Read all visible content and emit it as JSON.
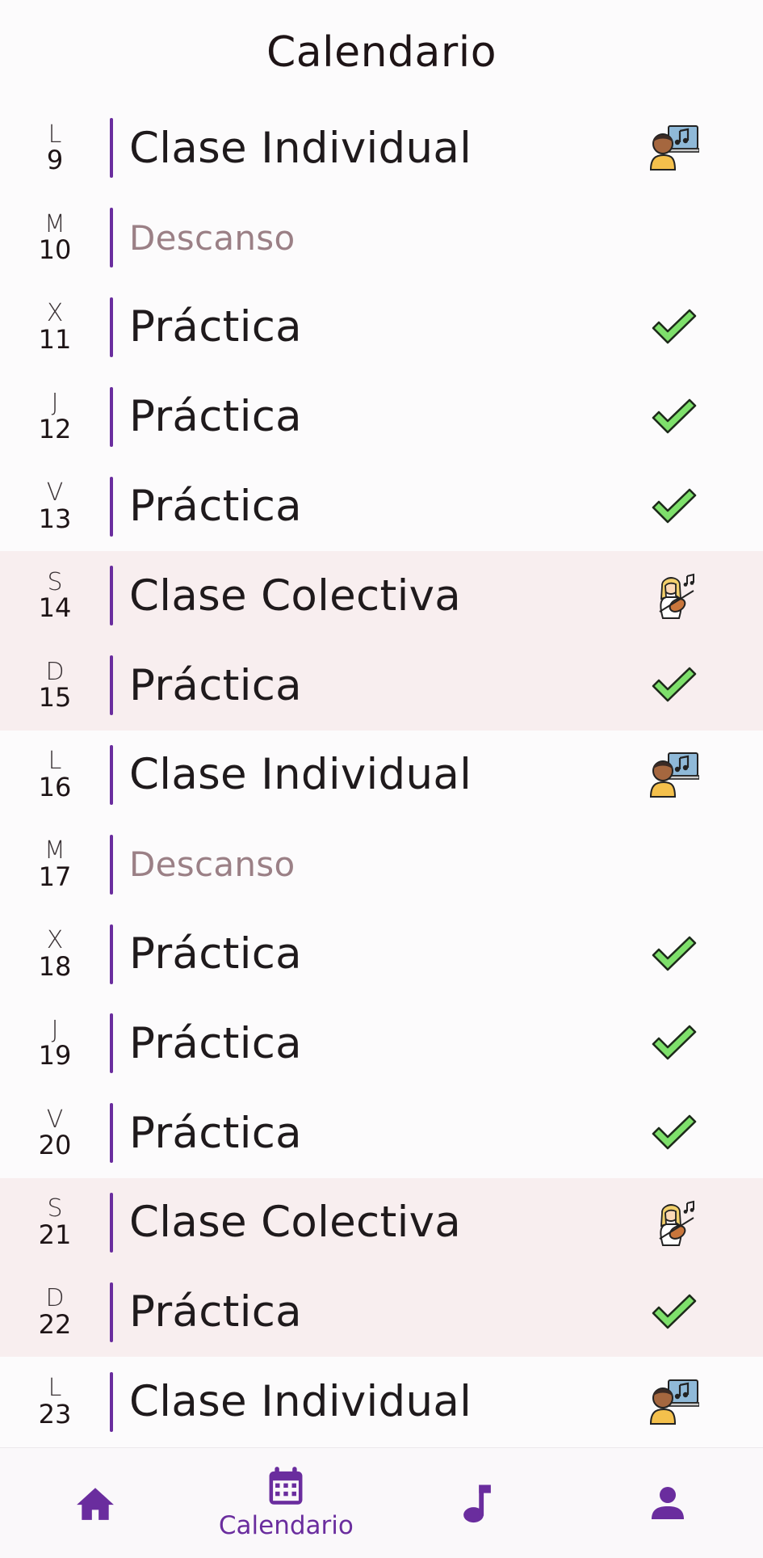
{
  "header": {
    "title": "Calendario"
  },
  "colors": {
    "accent": "#6a2d9e",
    "weekend_bg": "#f8eeef",
    "check": "#7ee06b"
  },
  "days": [
    {
      "dow": "L",
      "num": "9",
      "title": "Clase Individual",
      "type": "individual",
      "weekend": false
    },
    {
      "dow": "M",
      "num": "10",
      "title": "Descanso",
      "type": "rest",
      "weekend": false
    },
    {
      "dow": "X",
      "num": "11",
      "title": "Práctica",
      "type": "practice",
      "weekend": false
    },
    {
      "dow": "J",
      "num": "12",
      "title": "Práctica",
      "type": "practice",
      "weekend": false
    },
    {
      "dow": "V",
      "num": "13",
      "title": "Práctica",
      "type": "practice",
      "weekend": false
    },
    {
      "dow": "S",
      "num": "14",
      "title": "Clase Colectiva",
      "type": "group",
      "weekend": true
    },
    {
      "dow": "D",
      "num": "15",
      "title": "Práctica",
      "type": "practice",
      "weekend": true
    },
    {
      "dow": "L",
      "num": "16",
      "title": "Clase Individual",
      "type": "individual",
      "weekend": false
    },
    {
      "dow": "M",
      "num": "17",
      "title": "Descanso",
      "type": "rest",
      "weekend": false
    },
    {
      "dow": "X",
      "num": "18",
      "title": "Práctica",
      "type": "practice",
      "weekend": false
    },
    {
      "dow": "J",
      "num": "19",
      "title": "Práctica",
      "type": "practice",
      "weekend": false
    },
    {
      "dow": "V",
      "num": "20",
      "title": "Práctica",
      "type": "practice",
      "weekend": false
    },
    {
      "dow": "S",
      "num": "21",
      "title": "Clase Colectiva",
      "type": "group",
      "weekend": true
    },
    {
      "dow": "D",
      "num": "22",
      "title": "Práctica",
      "type": "practice",
      "weekend": true
    },
    {
      "dow": "L",
      "num": "23",
      "title": "Clase Individual",
      "type": "individual",
      "weekend": false
    }
  ],
  "status_icons": {
    "individual": "teacher-music-icon",
    "group": "violinist-icon",
    "practice": "check-icon",
    "rest": ""
  },
  "nav": {
    "items": [
      {
        "icon": "home-icon",
        "label": ""
      },
      {
        "icon": "calendar-icon",
        "label": "Calendario"
      },
      {
        "icon": "music-note-icon",
        "label": ""
      },
      {
        "icon": "profile-icon",
        "label": ""
      }
    ]
  }
}
